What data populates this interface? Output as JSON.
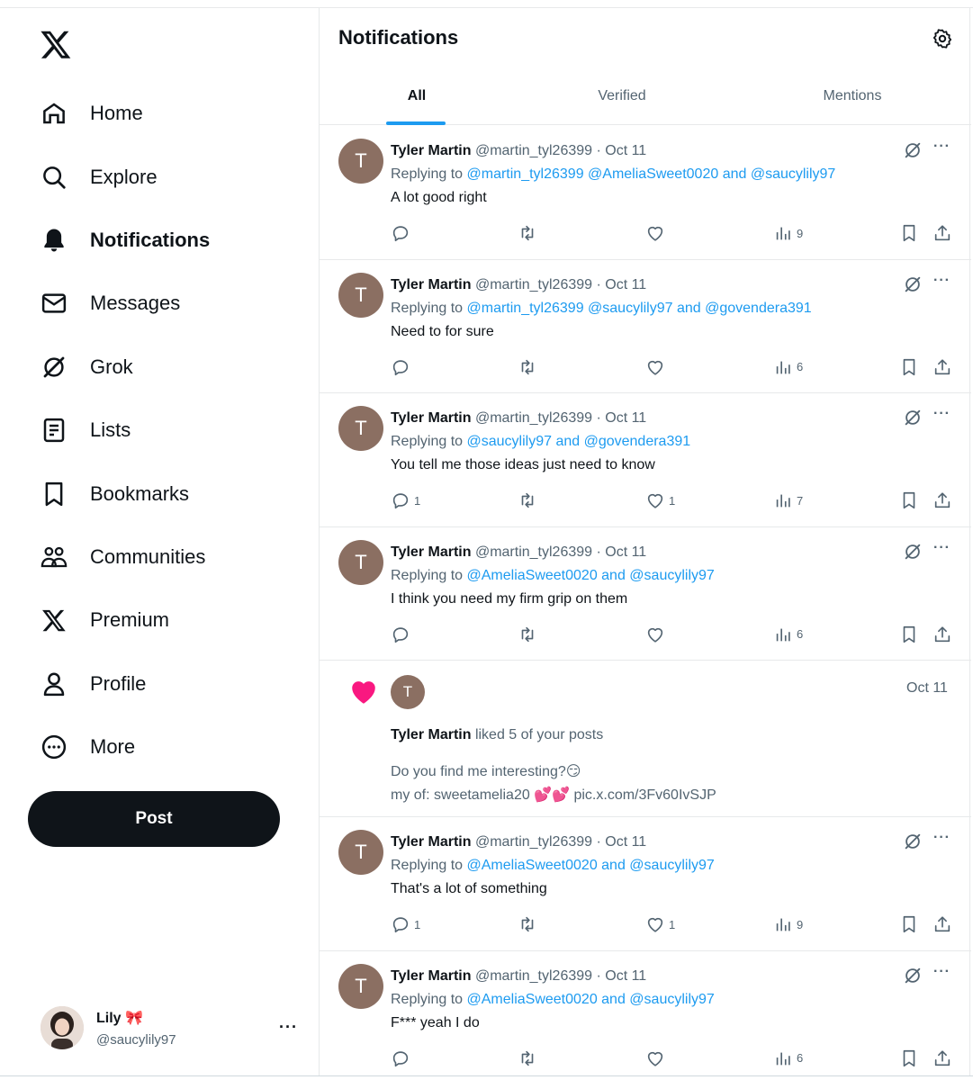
{
  "sidebar": {
    "logo": "x-logo-icon",
    "items": [
      {
        "label": "Home",
        "icon": "home-icon"
      },
      {
        "label": "Explore",
        "icon": "search-icon"
      },
      {
        "label": "Notifications",
        "icon": "bell-icon"
      },
      {
        "label": "Messages",
        "icon": "mail-icon"
      },
      {
        "label": "Grok",
        "icon": "grok-icon"
      },
      {
        "label": "Lists",
        "icon": "list-icon"
      },
      {
        "label": "Bookmarks",
        "icon": "bookmark-icon"
      },
      {
        "label": "Communities",
        "icon": "communities-icon"
      },
      {
        "label": "Premium",
        "icon": "x-icon"
      },
      {
        "label": "Profile",
        "icon": "person-icon"
      },
      {
        "label": "More",
        "icon": "more-circle-icon"
      }
    ],
    "active": "Notifications",
    "post_label": "Post",
    "account": {
      "name": "Lily 🎀",
      "handle": "@saucylily97"
    }
  },
  "header": {
    "title": "Notifications",
    "tabs": [
      {
        "label": "All"
      },
      {
        "label": "Verified"
      },
      {
        "label": "Mentions"
      }
    ]
  },
  "colors": {
    "accent": "#1d9bf0",
    "text": "#0f1419",
    "muted": "#536471",
    "like_pink": "#f91880"
  },
  "feed": {
    "t0": {
      "avatar": "T",
      "name": "Tyler Martin",
      "meta": "@martin_tyl26399 · Oct 11",
      "reply_prefix": "Replying to ",
      "reply_mentions": "@martin_tyl26399 @AmeliaSweet0020 and @saucylily97",
      "text": "A lot good right",
      "replies": "",
      "likes": "",
      "views": "9"
    },
    "t1": {
      "avatar": "T",
      "name": "Tyler Martin",
      "meta": "@martin_tyl26399 · Oct 11",
      "reply_prefix": "Replying to ",
      "reply_mentions": "@martin_tyl26399 @saucylily97 and @govendera391",
      "text": "Need to for sure",
      "replies": "",
      "likes": "",
      "views": "6"
    },
    "t2": {
      "avatar": "T",
      "name": "Tyler Martin",
      "meta": "@martin_tyl26399 · Oct 11",
      "reply_prefix": "Replying to ",
      "reply_mentions": "@saucylily97 and @govendera391",
      "text": "You tell me those ideas just need to know",
      "replies": "1",
      "likes": "1",
      "views": "7"
    },
    "t3": {
      "avatar": "T",
      "name": "Tyler Martin",
      "meta": "@martin_tyl26399 · Oct 11",
      "reply_prefix": "Replying to ",
      "reply_mentions": "@AmeliaSweet0020 and @saucylily97",
      "text": "I think you need my firm grip on them",
      "replies": "",
      "likes": "",
      "views": "6"
    },
    "like": {
      "avatar": "T",
      "date": "Oct 11",
      "name": "Tyler Martin",
      "action": " liked 5 of your posts",
      "post_line1": "Do you find me interesting?😏",
      "post_line2": "my of: sweetamelia20 💕💕 pic.x.com/3Fv60IvSJP"
    },
    "t4": {
      "avatar": "T",
      "name": "Tyler Martin",
      "meta": "@martin_tyl26399 · Oct 11",
      "reply_prefix": "Replying to ",
      "reply_mentions": "@AmeliaSweet0020 and @saucylily97",
      "text": "That's a lot of something",
      "replies": "1",
      "likes": "1",
      "views": "9"
    },
    "t5": {
      "avatar": "T",
      "name": "Tyler Martin",
      "meta": "@martin_tyl26399 · Oct 11",
      "reply_prefix": "Replying to ",
      "reply_mentions": "@AmeliaSweet0020 and @saucylily97",
      "text": "F*** yeah I do",
      "replies": "",
      "likes": "",
      "views": "6"
    }
  }
}
